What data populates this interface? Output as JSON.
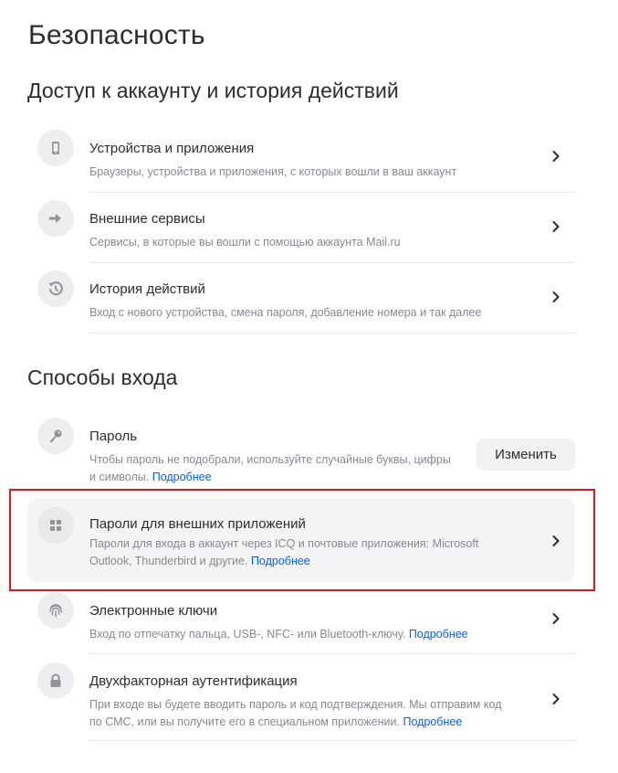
{
  "page": {
    "title": "Безопасность"
  },
  "sections": [
    {
      "title": "Доступ к аккаунту и история действий"
    },
    {
      "title": "Способы входа"
    }
  ],
  "access_items": [
    {
      "title": "Устройства и приложения",
      "desc": "Браузеры, устройства и приложения, с которых вошли в ваш аккаунт",
      "icon": "phone-icon"
    },
    {
      "title": "Внешние сервисы",
      "desc": "Сервисы, в которые вы вошли с помощью аккаунта Mail.ru",
      "icon": "arrow-right-icon"
    },
    {
      "title": "История действий",
      "desc": "Вход с нового устройства, смена пароля, добавление номера и так далее",
      "icon": "history-icon"
    }
  ],
  "login_items": [
    {
      "title": "Пароль",
      "desc": "Чтобы пароль не подобрали, используйте случайные буквы, цифры и символы.",
      "link": "Подробнее",
      "icon": "key-icon",
      "action_label": "Изменить"
    },
    {
      "title": "Пароли для внешних приложений",
      "desc": "Пароли для входа в аккаунт через ICQ и почтовые приложения: Microsoft Outlook, Thunderbird и другие.",
      "link": "Подробнее",
      "icon": "grid-icon"
    },
    {
      "title": "Электронные ключи",
      "desc": "Вход по отпечатку пальца, USB-, NFC- или Bluetooth-ключу.",
      "link": "Подробнее",
      "icon": "fingerprint-icon"
    },
    {
      "title": "Двухфакторная аутентификация",
      "desc": "При входе вы будете вводить пароль и код подтверждения. Мы отправим код по СМС, или вы получите его в специальном приложении.",
      "link": "Подробнее",
      "icon": "lock-icon"
    }
  ],
  "colors": {
    "link": "#005ff9",
    "highlight": "#e0161b",
    "selected_bg": "#f3f4f5"
  }
}
